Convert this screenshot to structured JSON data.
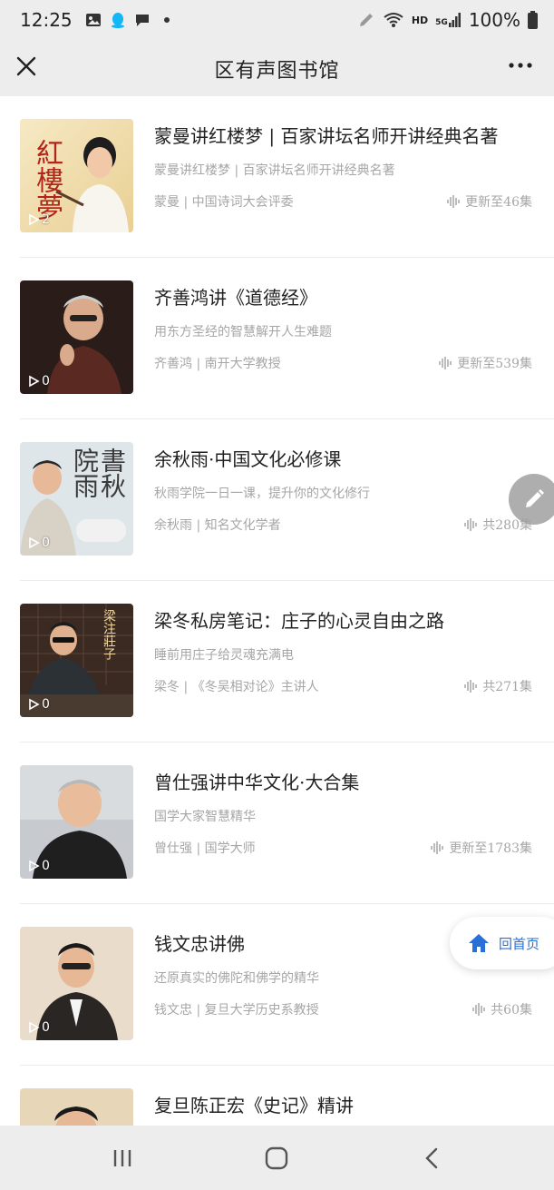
{
  "status_bar": {
    "time": "12:25",
    "hd": "HD",
    "network": "5G",
    "battery": "100%"
  },
  "header": {
    "title": "区有声图书馆"
  },
  "items": [
    {
      "title": "蒙曼讲红楼梦 | 百家讲坛名师开讲经典名著",
      "desc": "蒙曼讲红楼梦 | 百家讲坛名师开讲经典名著",
      "author": "蒙曼 | 中国诗词大会评委",
      "count": "更新至46集",
      "plays": "2",
      "cover_text": "紅樓夢"
    },
    {
      "title": "齐善鸿讲《道德经》",
      "desc": "用东方圣经的智慧解开人生难题",
      "author": "齐善鸿 | 南开大学教授",
      "count": "更新至539集",
      "plays": "0"
    },
    {
      "title": "余秋雨·中国文化必修课",
      "desc": "秋雨学院一日一课，提升你的文化修行",
      "author": "余秋雨 | 知名文化学者",
      "count": "共280集",
      "plays": "0",
      "cover_text": "書秋 院雨"
    },
    {
      "title": "梁冬私房笔记：庄子的心灵自由之路",
      "desc": "睡前用庄子给灵魂充满电",
      "author": "梁冬 | 《冬吴相对论》主讲人",
      "count": "共271集",
      "plays": "0",
      "cover_text": "梁注莊子"
    },
    {
      "title": "曾仕强讲中华文化·大合集",
      "desc": "国学大家智慧精华",
      "author": "曾仕强 | 国学大师",
      "count": "更新至1783集",
      "plays": "0"
    },
    {
      "title": "钱文忠讲佛",
      "desc": "还原真实的佛陀和佛学的精华",
      "author": "钱文忠 | 复旦大学历史系教授",
      "count": "共60集",
      "plays": "0"
    },
    {
      "title": "复旦陈正宏《史记》精讲",
      "desc": "",
      "author": "",
      "count": "",
      "plays": ""
    }
  ],
  "home_button": {
    "label": "回首页"
  },
  "colors": {
    "chrome": "#ededed",
    "muted_text": "#a6a6a6",
    "link_blue": "#2a6fd6"
  }
}
